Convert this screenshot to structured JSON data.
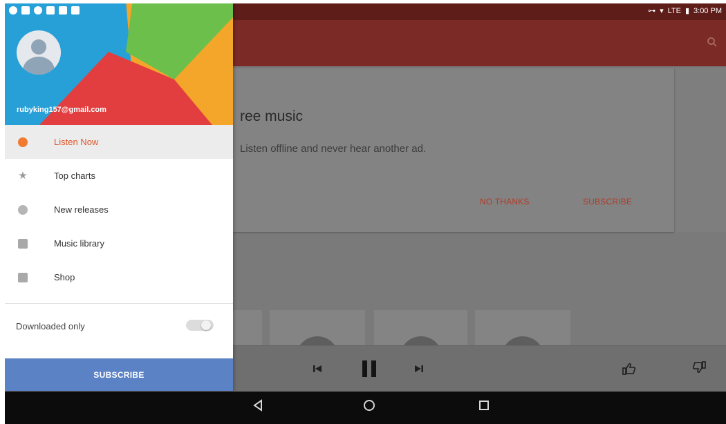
{
  "status_bar": {
    "time": "3:00 PM",
    "network": "LTE",
    "left_icons": [
      "sync-icon",
      "mail-icon",
      "record-icon",
      "sdcard-icon",
      "clipboard-icon",
      "message-icon"
    ]
  },
  "colors": {
    "toolbar": "#7b2a26",
    "accent": "#e0562a",
    "header_blue": "#27a0d8",
    "subscribe_blue": "#5b82c4"
  },
  "drawer": {
    "email": "rubyking157@gmail.com",
    "items": [
      {
        "label": "Listen Now",
        "icon": "listen-now-icon",
        "active": true
      },
      {
        "label": "Top charts",
        "icon": "star-icon",
        "active": false
      },
      {
        "label": "New releases",
        "icon": "new-releases-icon",
        "active": false
      },
      {
        "label": "Music library",
        "icon": "music-library-icon",
        "active": false
      },
      {
        "label": "Shop",
        "icon": "shop-icon",
        "active": false
      }
    ],
    "downloaded_only_label": "Downloaded only",
    "downloaded_only_on": false,
    "subscribe_label": "SUBSCRIBE"
  },
  "card": {
    "title": "ree music",
    "body": "Listen offline and never hear another ad.",
    "no_thanks": "NO THANKS",
    "subscribe": "SUBSCRIBE"
  }
}
